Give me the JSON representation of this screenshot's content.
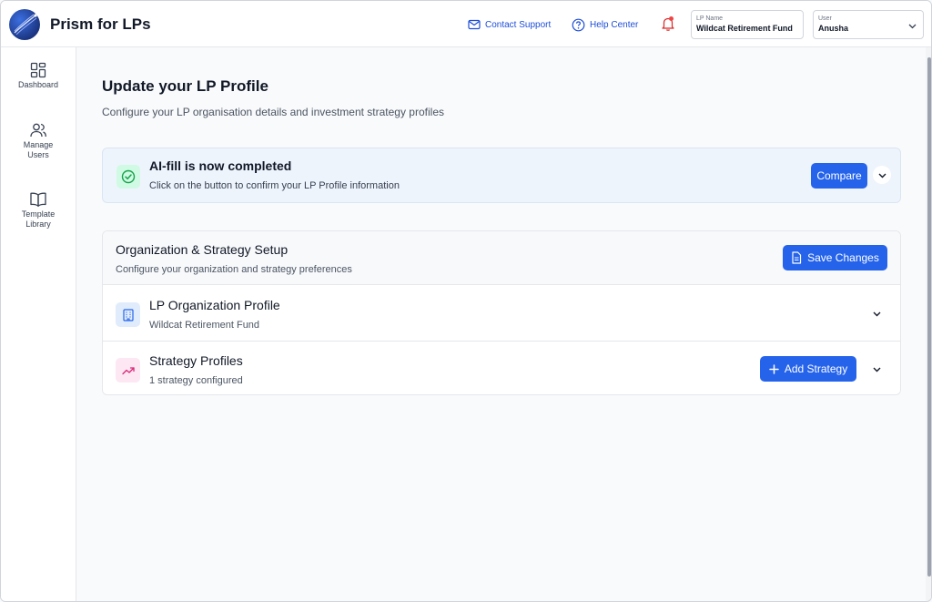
{
  "header": {
    "app_title": "Prism for LPs",
    "contact_support": "Contact Support",
    "help_center": "Help Center",
    "lp_name_label": "LP Name",
    "lp_name_value": "Wildcat Retirement Fund",
    "user_label": "User",
    "user_value": "Anusha"
  },
  "sidebar": {
    "items": [
      {
        "label": "Dashboard",
        "icon": "dashboard-icon"
      },
      {
        "label": "Manage\nUsers",
        "icon": "users-icon"
      },
      {
        "label": "Template\nLibrary",
        "icon": "book-icon"
      }
    ]
  },
  "main": {
    "title": "Update your LP Profile",
    "subtitle": "Configure your LP organisation details and investment strategy profiles",
    "ai_fill": {
      "title": "AI-fill is now completed",
      "subtitle": "Click on the button to confirm your LP Profile information",
      "compare_label": "Compare"
    },
    "setup": {
      "title": "Organization & Strategy Setup",
      "subtitle": "Configure your organization and strategy preferences",
      "save_label": "Save Changes",
      "rows": [
        {
          "title": "LP Organization Profile",
          "subtitle": "Wildcat Retirement Fund",
          "icon": "building-icon"
        },
        {
          "title": "Strategy Profiles",
          "subtitle": "1 strategy configured",
          "icon": "trending-up-icon",
          "action_label": "Add Strategy"
        }
      ]
    }
  },
  "colors": {
    "accent": "#2563eb",
    "link": "#1d4ed8",
    "success_bg": "#d1fae5",
    "success": "#16a34a",
    "notification_dot": "#ef4444",
    "strategy_icon_bg": "#fce7f3",
    "strategy_icon": "#db2777"
  }
}
